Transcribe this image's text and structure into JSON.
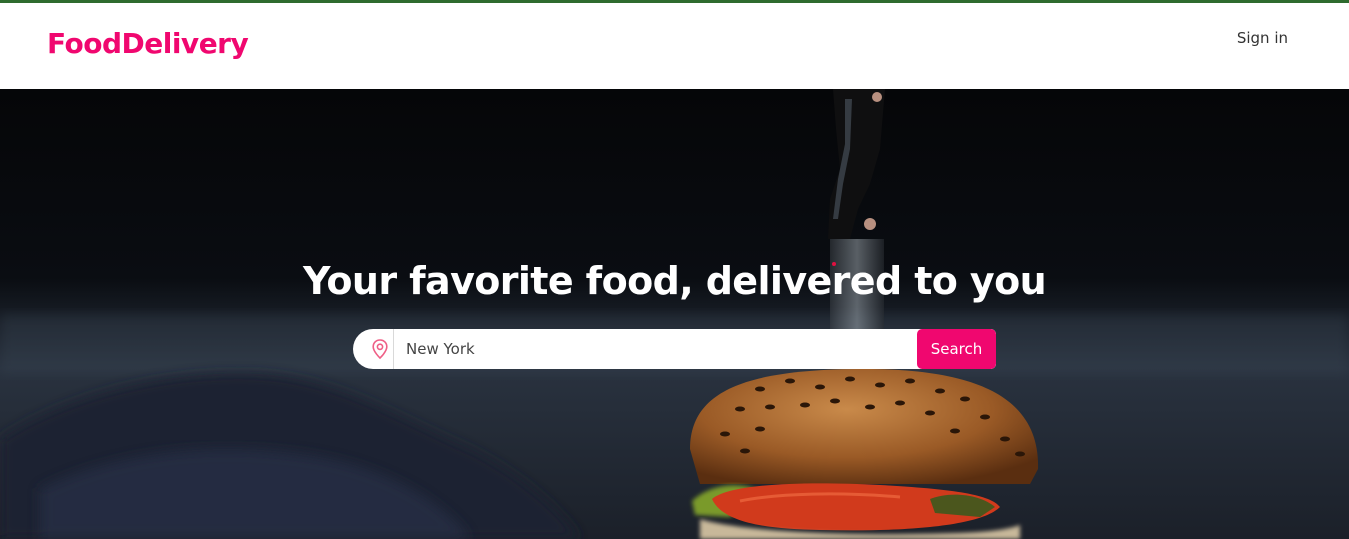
{
  "header": {
    "brand": "FoodDelivery",
    "sign_in": "Sign in"
  },
  "hero": {
    "title": "Your favorite food, delivered to you",
    "search": {
      "location_value": "New York",
      "location_placeholder": "",
      "button_label": "Search",
      "location_icon": "map-pin-icon"
    }
  },
  "colors": {
    "brand": "#f0076f",
    "top_strip": "#2e6b2e",
    "hero_background": "#000000"
  }
}
